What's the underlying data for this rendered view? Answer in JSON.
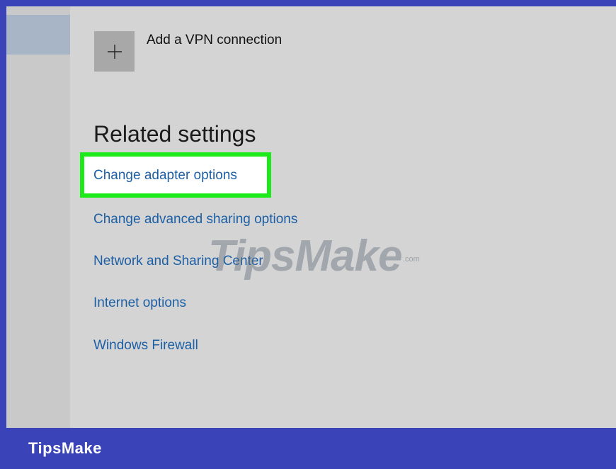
{
  "vpn": {
    "add_label": "Add a VPN connection",
    "icon": "plus-icon"
  },
  "related": {
    "title": "Related settings",
    "links": [
      "Change adapter options",
      "Change advanced sharing options",
      "Network and Sharing Center",
      "Internet options",
      "Windows Firewall"
    ]
  },
  "watermark": {
    "text": "TipsMake",
    "suffix": ".com"
  },
  "footer": {
    "brand": "TipsMake"
  },
  "colors": {
    "frame": "#3a44b8",
    "link": "#1d5fa5",
    "highlight": "#1dea1a",
    "window_bg": "#d4d4d4"
  }
}
